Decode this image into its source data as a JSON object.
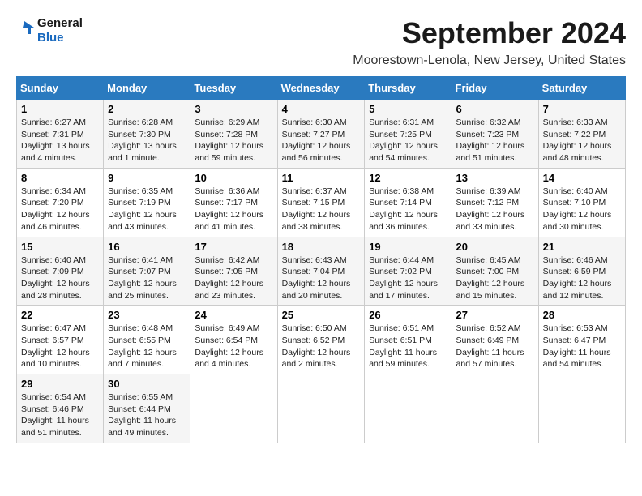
{
  "logo": {
    "line1": "General",
    "line2": "Blue"
  },
  "title": "September 2024",
  "location": "Moorestown-Lenola, New Jersey, United States",
  "days_of_week": [
    "Sunday",
    "Monday",
    "Tuesday",
    "Wednesday",
    "Thursday",
    "Friday",
    "Saturday"
  ],
  "weeks": [
    [
      {
        "day": "1",
        "info": "Sunrise: 6:27 AM\nSunset: 7:31 PM\nDaylight: 13 hours\nand 4 minutes."
      },
      {
        "day": "2",
        "info": "Sunrise: 6:28 AM\nSunset: 7:30 PM\nDaylight: 13 hours\nand 1 minute."
      },
      {
        "day": "3",
        "info": "Sunrise: 6:29 AM\nSunset: 7:28 PM\nDaylight: 12 hours\nand 59 minutes."
      },
      {
        "day": "4",
        "info": "Sunrise: 6:30 AM\nSunset: 7:27 PM\nDaylight: 12 hours\nand 56 minutes."
      },
      {
        "day": "5",
        "info": "Sunrise: 6:31 AM\nSunset: 7:25 PM\nDaylight: 12 hours\nand 54 minutes."
      },
      {
        "day": "6",
        "info": "Sunrise: 6:32 AM\nSunset: 7:23 PM\nDaylight: 12 hours\nand 51 minutes."
      },
      {
        "day": "7",
        "info": "Sunrise: 6:33 AM\nSunset: 7:22 PM\nDaylight: 12 hours\nand 48 minutes."
      }
    ],
    [
      {
        "day": "8",
        "info": "Sunrise: 6:34 AM\nSunset: 7:20 PM\nDaylight: 12 hours\nand 46 minutes."
      },
      {
        "day": "9",
        "info": "Sunrise: 6:35 AM\nSunset: 7:19 PM\nDaylight: 12 hours\nand 43 minutes."
      },
      {
        "day": "10",
        "info": "Sunrise: 6:36 AM\nSunset: 7:17 PM\nDaylight: 12 hours\nand 41 minutes."
      },
      {
        "day": "11",
        "info": "Sunrise: 6:37 AM\nSunset: 7:15 PM\nDaylight: 12 hours\nand 38 minutes."
      },
      {
        "day": "12",
        "info": "Sunrise: 6:38 AM\nSunset: 7:14 PM\nDaylight: 12 hours\nand 36 minutes."
      },
      {
        "day": "13",
        "info": "Sunrise: 6:39 AM\nSunset: 7:12 PM\nDaylight: 12 hours\nand 33 minutes."
      },
      {
        "day": "14",
        "info": "Sunrise: 6:40 AM\nSunset: 7:10 PM\nDaylight: 12 hours\nand 30 minutes."
      }
    ],
    [
      {
        "day": "15",
        "info": "Sunrise: 6:40 AM\nSunset: 7:09 PM\nDaylight: 12 hours\nand 28 minutes."
      },
      {
        "day": "16",
        "info": "Sunrise: 6:41 AM\nSunset: 7:07 PM\nDaylight: 12 hours\nand 25 minutes."
      },
      {
        "day": "17",
        "info": "Sunrise: 6:42 AM\nSunset: 7:05 PM\nDaylight: 12 hours\nand 23 minutes."
      },
      {
        "day": "18",
        "info": "Sunrise: 6:43 AM\nSunset: 7:04 PM\nDaylight: 12 hours\nand 20 minutes."
      },
      {
        "day": "19",
        "info": "Sunrise: 6:44 AM\nSunset: 7:02 PM\nDaylight: 12 hours\nand 17 minutes."
      },
      {
        "day": "20",
        "info": "Sunrise: 6:45 AM\nSunset: 7:00 PM\nDaylight: 12 hours\nand 15 minutes."
      },
      {
        "day": "21",
        "info": "Sunrise: 6:46 AM\nSunset: 6:59 PM\nDaylight: 12 hours\nand 12 minutes."
      }
    ],
    [
      {
        "day": "22",
        "info": "Sunrise: 6:47 AM\nSunset: 6:57 PM\nDaylight: 12 hours\nand 10 minutes."
      },
      {
        "day": "23",
        "info": "Sunrise: 6:48 AM\nSunset: 6:55 PM\nDaylight: 12 hours\nand 7 minutes."
      },
      {
        "day": "24",
        "info": "Sunrise: 6:49 AM\nSunset: 6:54 PM\nDaylight: 12 hours\nand 4 minutes."
      },
      {
        "day": "25",
        "info": "Sunrise: 6:50 AM\nSunset: 6:52 PM\nDaylight: 12 hours\nand 2 minutes."
      },
      {
        "day": "26",
        "info": "Sunrise: 6:51 AM\nSunset: 6:51 PM\nDaylight: 11 hours\nand 59 minutes."
      },
      {
        "day": "27",
        "info": "Sunrise: 6:52 AM\nSunset: 6:49 PM\nDaylight: 11 hours\nand 57 minutes."
      },
      {
        "day": "28",
        "info": "Sunrise: 6:53 AM\nSunset: 6:47 PM\nDaylight: 11 hours\nand 54 minutes."
      }
    ],
    [
      {
        "day": "29",
        "info": "Sunrise: 6:54 AM\nSunset: 6:46 PM\nDaylight: 11 hours\nand 51 minutes."
      },
      {
        "day": "30",
        "info": "Sunrise: 6:55 AM\nSunset: 6:44 PM\nDaylight: 11 hours\nand 49 minutes."
      },
      null,
      null,
      null,
      null,
      null
    ]
  ],
  "colors": {
    "header_bg": "#2a7abf",
    "header_text": "#ffffff",
    "odd_row": "#f5f5f5",
    "even_row": "#ffffff"
  }
}
